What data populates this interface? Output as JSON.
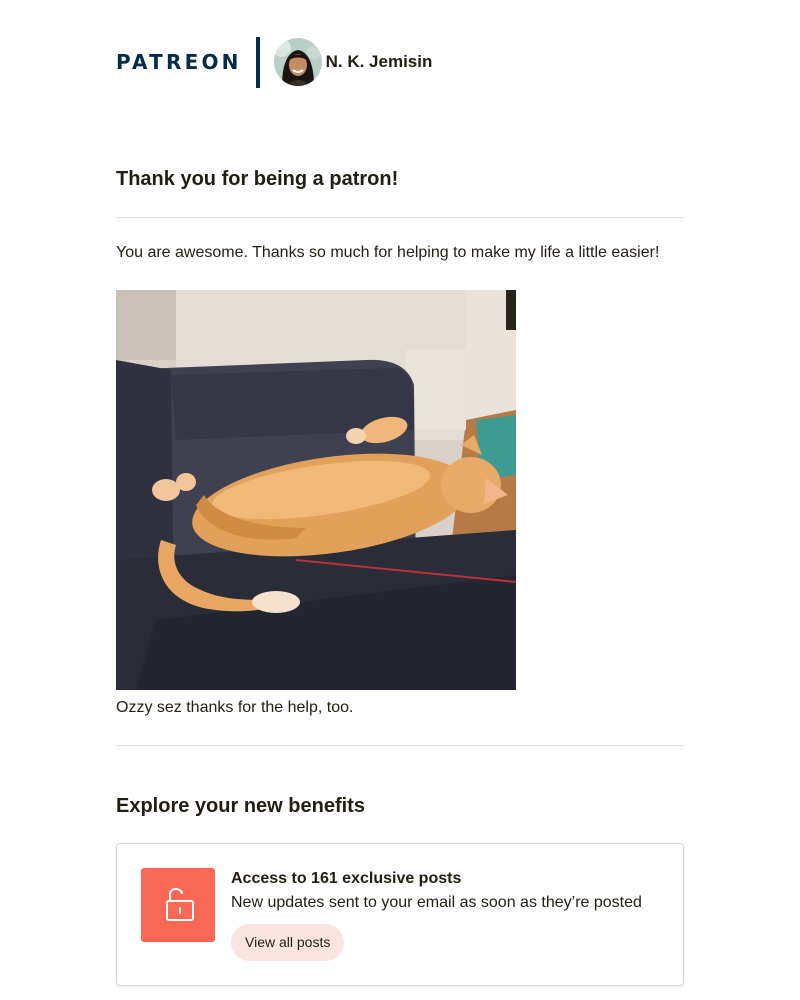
{
  "header": {
    "brand": "PATREON",
    "creator_name": "N. K. Jemisin",
    "brand_color": "#052d49"
  },
  "main": {
    "title": "Thank you for being a patron!",
    "message": "You are awesome. Thanks so much for helping to make my life a little easier!",
    "photo_caption": "Ozzy sez thanks for the help, too."
  },
  "benefits": {
    "title": "Explore your new benefits",
    "items": [
      {
        "icon": "unlock-icon",
        "heading": "Access to 161 exclusive posts",
        "description": "New updates sent to your email as soon as they’re posted",
        "button_label": "View all posts",
        "icon_color": "#f96854",
        "button_color": "#fbe4e1"
      }
    ]
  }
}
